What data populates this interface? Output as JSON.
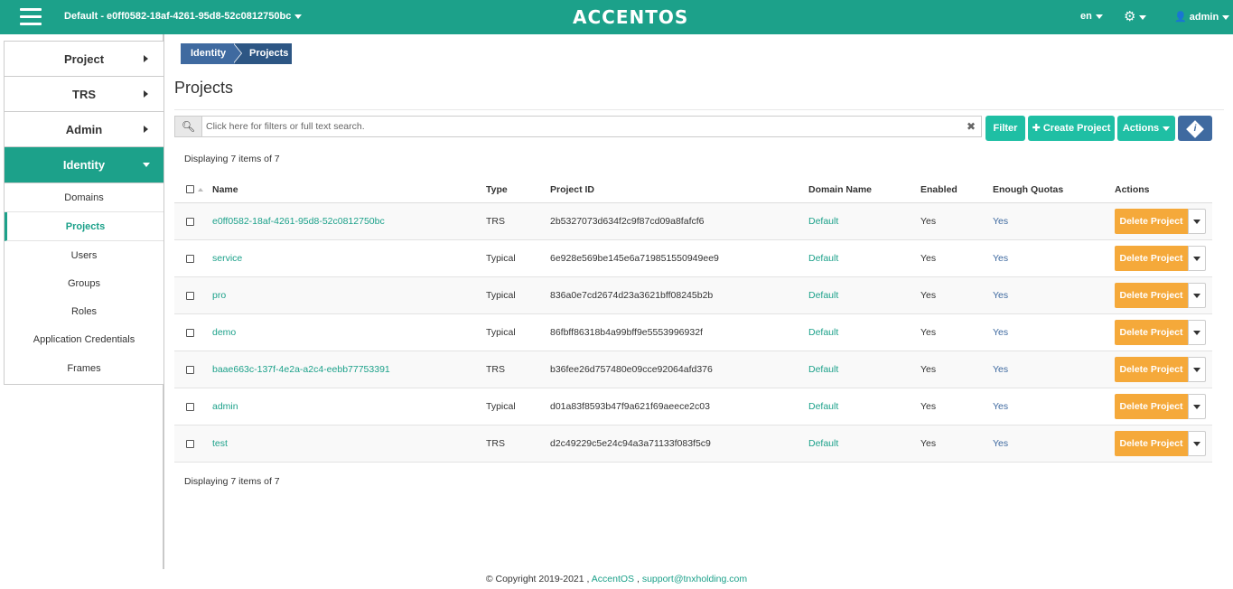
{
  "topbar": {
    "project_selector": "Default - e0ff0582-18af-4261-95d8-52c0812750bc",
    "logo": "ACCENTOS",
    "language": "en",
    "user": "admin",
    "brand_color": "#1ca18a"
  },
  "sidebar": {
    "items": [
      {
        "label": "Project"
      },
      {
        "label": "TRS"
      },
      {
        "label": "Admin"
      },
      {
        "label": "Identity"
      }
    ],
    "identity_sub": [
      {
        "label": "Domains"
      },
      {
        "label": "Projects"
      },
      {
        "label": "Users"
      },
      {
        "label": "Groups"
      },
      {
        "label": "Roles"
      },
      {
        "label": "Application Credentials"
      },
      {
        "label": "Frames"
      }
    ]
  },
  "breadcrumb": {
    "parent": "Identity",
    "current": "Projects"
  },
  "page": {
    "title": "Projects"
  },
  "search": {
    "placeholder": "Click here for filters or full text search."
  },
  "toolbar": {
    "filter_label": "Filter",
    "create_label": "Create Project",
    "actions_label": "Actions"
  },
  "table": {
    "count_text": "Displaying 7 items of 7",
    "headers": [
      "Name",
      "Type",
      "Project ID",
      "Domain Name",
      "Enabled",
      "Enough Quotas",
      "Actions"
    ],
    "rows": [
      {
        "name": "e0ff0582-18af-4261-95d8-52c0812750bc",
        "type": "TRS",
        "id": "2b5327073d634f2c9f87cd09a8fafcf6",
        "domain": "Default",
        "enabled": "Yes",
        "quotas": "Yes",
        "action": "Delete Project"
      },
      {
        "name": "service",
        "type": "Typical",
        "id": "6e928e569be145e6a719851550949ee9",
        "domain": "Default",
        "enabled": "Yes",
        "quotas": "Yes",
        "action": "Delete Project"
      },
      {
        "name": "pro",
        "type": "Typical",
        "id": "836a0e7cd2674d23a3621bff08245b2b",
        "domain": "Default",
        "enabled": "Yes",
        "quotas": "Yes",
        "action": "Delete Project"
      },
      {
        "name": "demo",
        "type": "Typical",
        "id": "86fbff86318b4a99bff9e5553996932f",
        "domain": "Default",
        "enabled": "Yes",
        "quotas": "Yes",
        "action": "Delete Project"
      },
      {
        "name": "baae663c-137f-4e2a-a2c4-eebb77753391",
        "type": "TRS",
        "id": "b36fee26d757480e09cce92064afd376",
        "domain": "Default",
        "enabled": "Yes",
        "quotas": "Yes",
        "action": "Delete Project"
      },
      {
        "name": "admin",
        "type": "Typical",
        "id": "d01a83f8593b47f9a621f69aeece2c03",
        "domain": "Default",
        "enabled": "Yes",
        "quotas": "Yes",
        "action": "Delete Project"
      },
      {
        "name": "test",
        "type": "TRS",
        "id": "d2c49229c5e24c94a3a71133f083f5c9",
        "domain": "Default",
        "enabled": "Yes",
        "quotas": "Yes",
        "action": "Delete Project"
      }
    ]
  },
  "footer": {
    "copyright": "© Copyright 2019-2021 ,",
    "brand_link": "AccentOS",
    "separator": ",",
    "support_link": "support@tnxholding.com"
  }
}
